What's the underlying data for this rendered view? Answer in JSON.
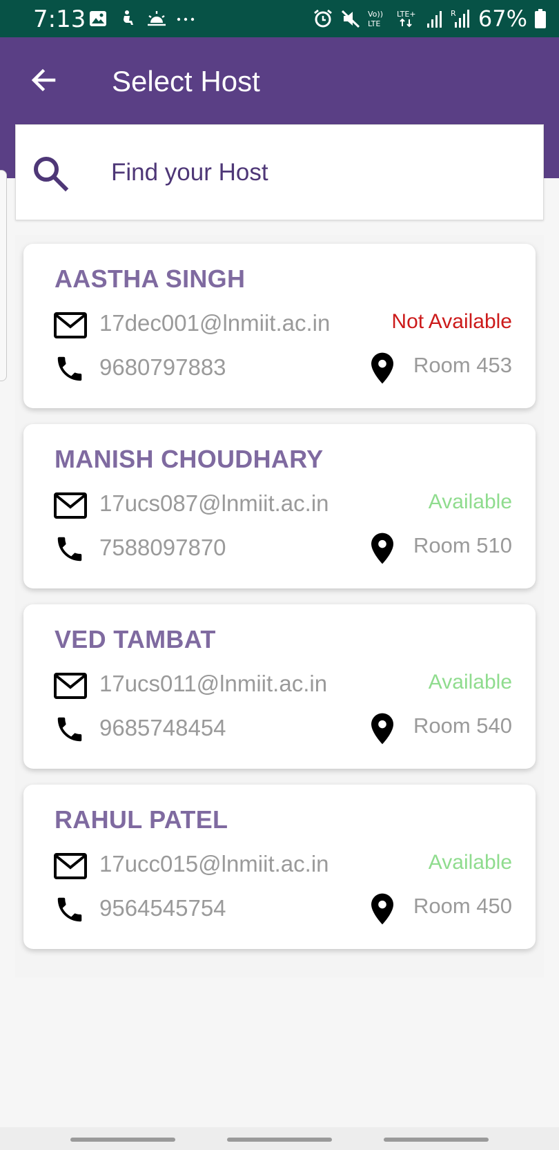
{
  "status_bar": {
    "time": "7:13",
    "battery": "67%",
    "left_icons": [
      "image-icon",
      "accessibility-icon",
      "weather-sunrise-icon",
      "more-dots-icon"
    ],
    "right_icons": [
      "alarm-icon",
      "mute-icon",
      "volte-icon",
      "lte-icon",
      "signal-icon",
      "signal-roaming-icon",
      "battery-icon"
    ]
  },
  "app_bar": {
    "title": "Select Host",
    "back_icon": "arrow-back-icon",
    "color": "#5a3f85"
  },
  "search": {
    "placeholder": "Find your Host",
    "value": "",
    "icon": "search-icon"
  },
  "hosts": [
    {
      "name": "AASTHA SINGH",
      "email": "17dec001@lnmiit.ac.in",
      "status": "Not Available",
      "phone": "9680797883",
      "room": "Room 453"
    },
    {
      "name": "MANISH CHOUDHARY",
      "email": "17ucs087@lnmiit.ac.in",
      "status": "Available",
      "phone": "7588097870",
      "room": "Room 510"
    },
    {
      "name": "VED TAMBAT",
      "email": "17ucs011@lnmiit.ac.in",
      "status": "Available",
      "phone": "9685748454",
      "room": "Room 540"
    },
    {
      "name": "RAHUL PATEL",
      "email": "17ucc015@lnmiit.ac.in",
      "status": "Available",
      "phone": "9564545754",
      "room": "Room 450"
    }
  ],
  "colors": {
    "status_bar": "#075246",
    "host_name": "#7f6aa0",
    "not_available": "#cc1a1a",
    "available": "#8fdc8e"
  }
}
